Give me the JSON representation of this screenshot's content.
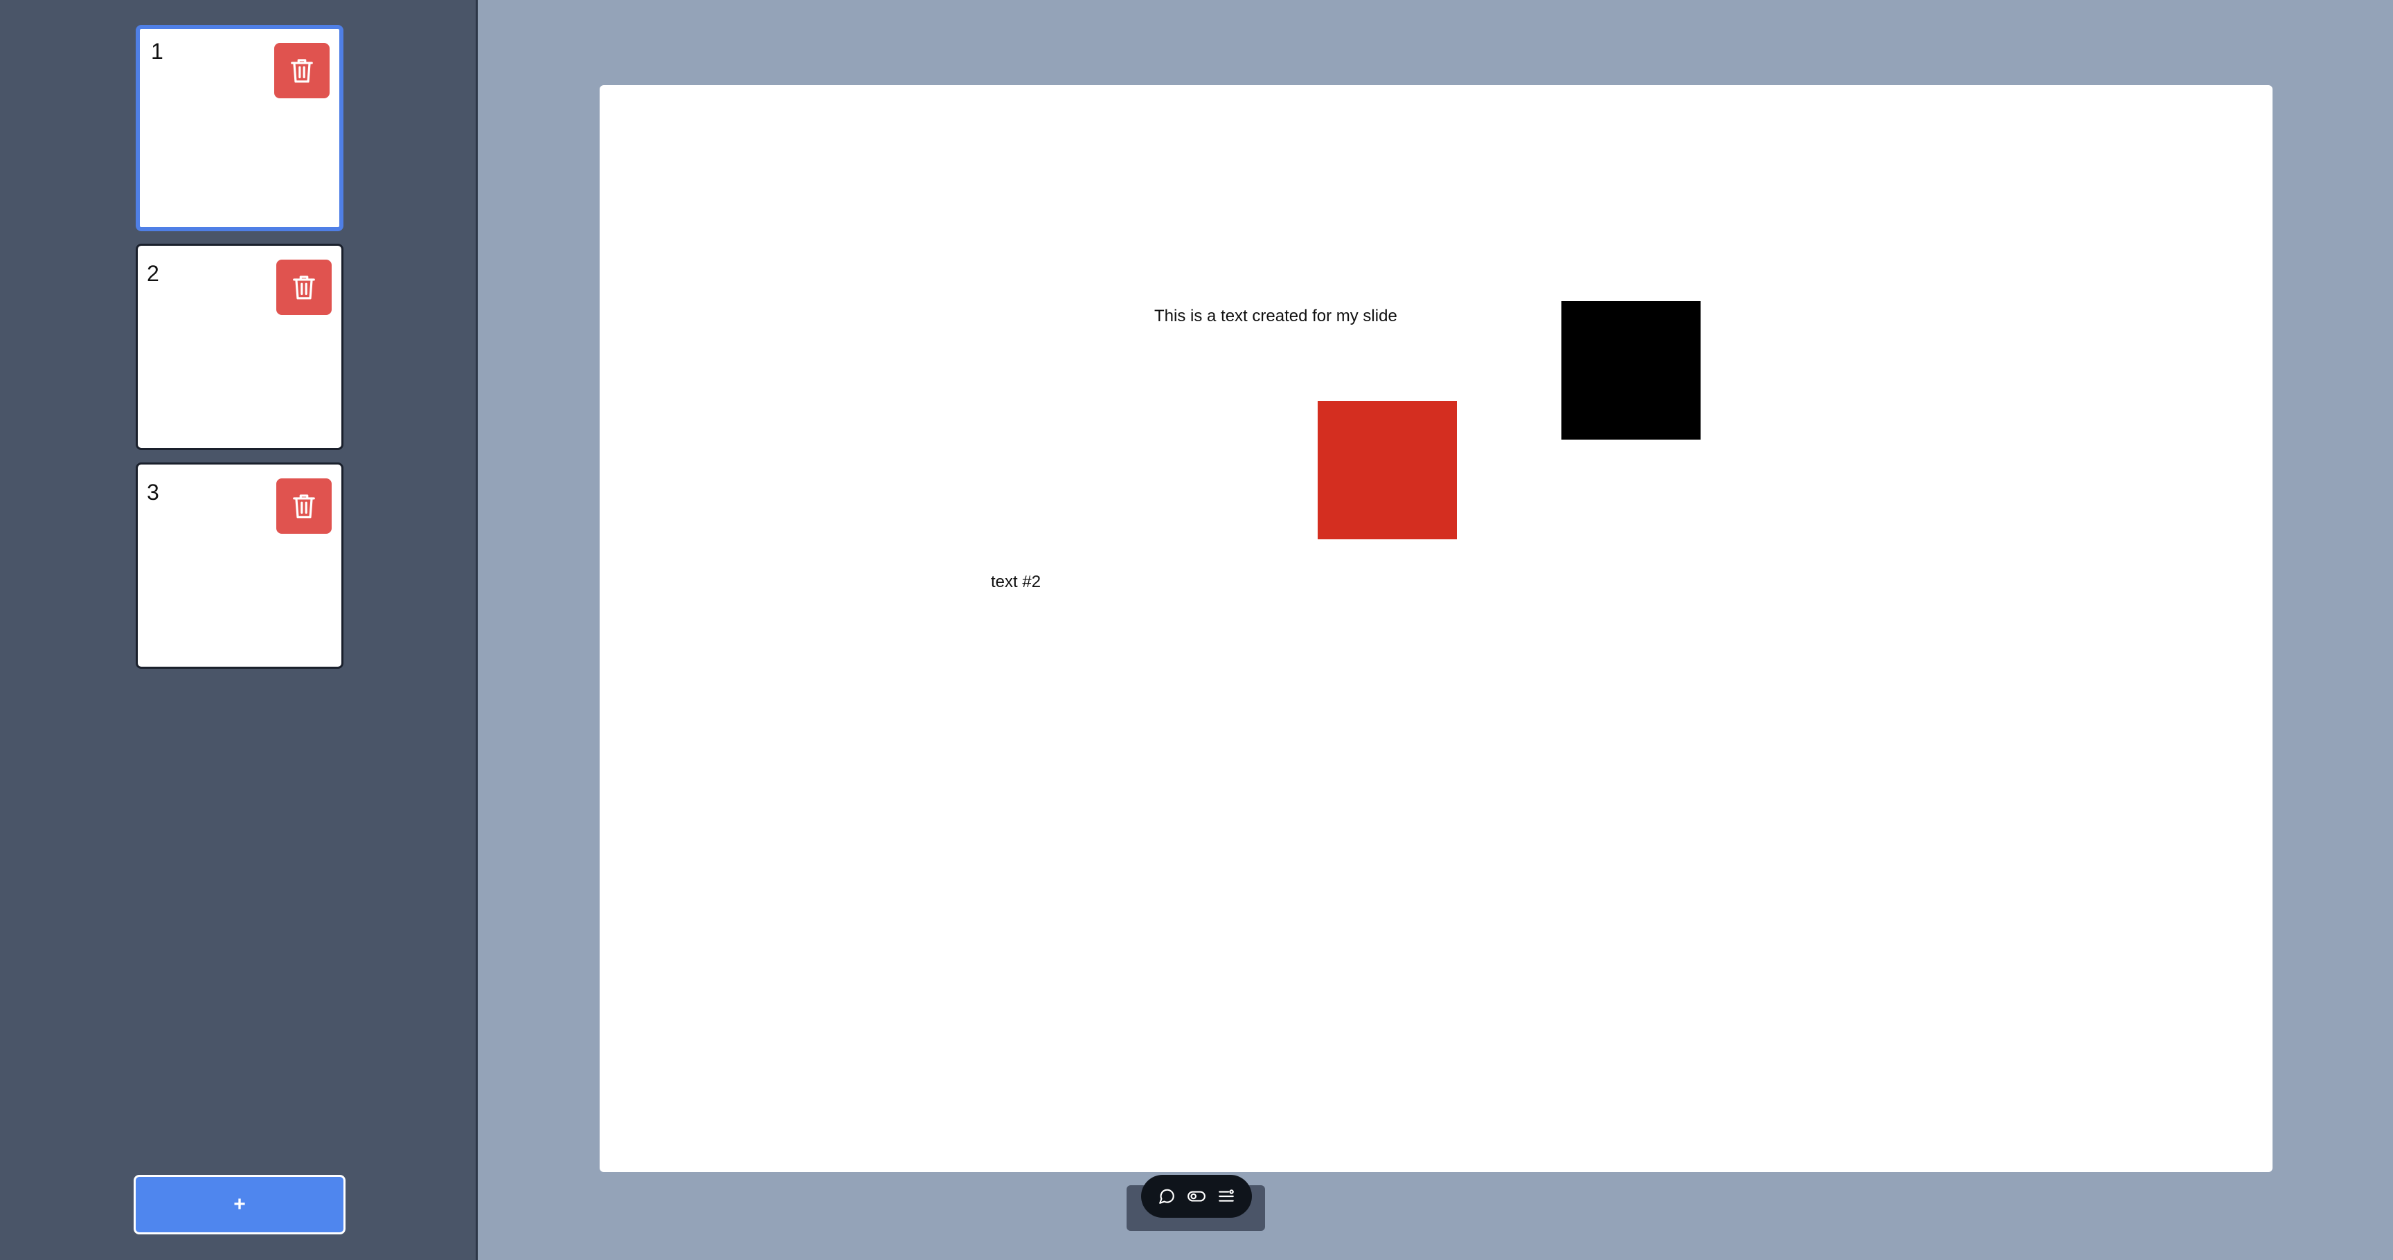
{
  "sidebar": {
    "slides": [
      {
        "number": "1",
        "active": true
      },
      {
        "number": "2",
        "active": false
      },
      {
        "number": "3",
        "active": false
      }
    ],
    "add_label": "+"
  },
  "canvas": {
    "texts": {
      "text1": "This is a text created for my slide",
      "text2": "text #2"
    },
    "shapes": {
      "red_square_color": "#d42e20",
      "black_square_color": "#000000"
    }
  },
  "toolbar": {
    "icons": [
      "comment-icon",
      "toggle-icon",
      "list-settings-icon"
    ]
  },
  "colors": {
    "accent": "#4f86ee",
    "delete": "#e0534f",
    "sidebar_bg": "#4a5568",
    "workspace_bg": "#94a3b8"
  }
}
